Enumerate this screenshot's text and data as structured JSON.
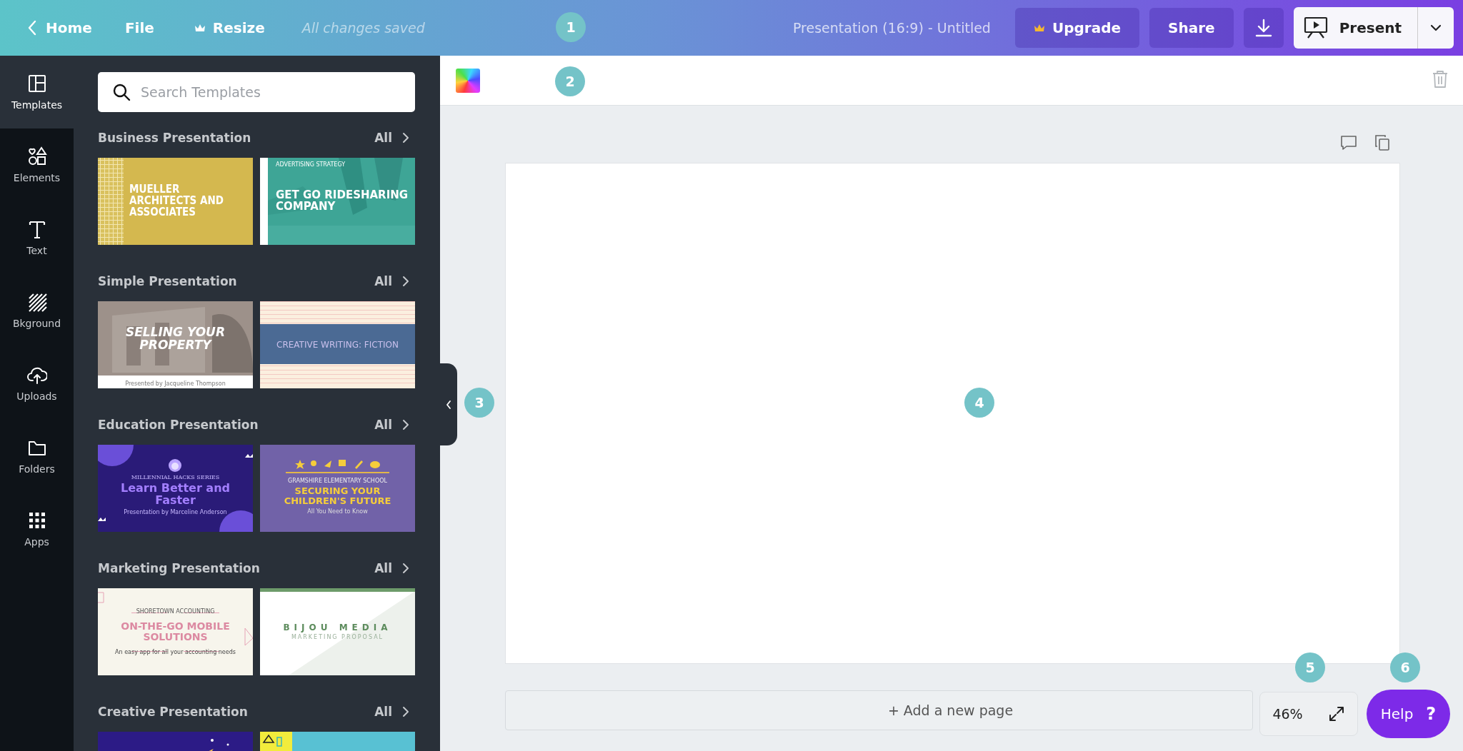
{
  "top_bar": {
    "home_link": "Home",
    "file_menu": "File",
    "resize_menu": "Resize",
    "save_status": "All changes saved",
    "document_title": "Presentation (16:9) - Untitled",
    "upgrade_button": "Upgrade",
    "share_button": "Share",
    "present_button": "Present"
  },
  "side_rail": [
    {
      "label": "Templates",
      "selected": true
    },
    {
      "label": "Elements",
      "selected": false
    },
    {
      "label": "Text",
      "selected": false
    },
    {
      "label": "Bkground",
      "selected": false
    },
    {
      "label": "Uploads",
      "selected": false
    },
    {
      "label": "Folders",
      "selected": false
    },
    {
      "label": "Apps",
      "selected": false
    }
  ],
  "template_panel": {
    "search": {
      "placeholder": "Search Templates"
    },
    "sections": [
      {
        "title": "Business Presentation",
        "all_link": "All",
        "templates": [
          {
            "kind": "design",
            "texts": [
              {
                "kind": "title",
                "text": "MUELLER ARCHITECTS AND ASSOCIATES"
              }
            ]
          },
          {
            "kind": "design",
            "texts": [
              {
                "kind": "kicker",
                "text": "ADVERTISING STRATEGY"
              },
              {
                "kind": "title",
                "text": "GET GO RIDESHARING COMPANY"
              }
            ]
          }
        ]
      },
      {
        "title": "Simple Presentation",
        "all_link": "All",
        "templates": [
          {
            "kind": "design",
            "texts": [
              {
                "kind": "title",
                "text": "SELLING YOUR PROPERTY"
              },
              {
                "kind": "footer",
                "text": "Presented by Jacqueline Thompson"
              }
            ]
          },
          {
            "kind": "design",
            "texts": [
              {
                "kind": "title",
                "text": "CREATIVE WRITING: FICTION"
              }
            ]
          }
        ]
      },
      {
        "title": "Education Presentation",
        "all_link": "All",
        "templates": [
          {
            "kind": "design",
            "texts": [
              {
                "kind": "kicker",
                "text": "MILLENNIAL HACKS SERIES"
              },
              {
                "kind": "title",
                "text": "Learn Better and Faster"
              },
              {
                "kind": "byline",
                "text": "Presentation by Marceline Anderson"
              }
            ]
          },
          {
            "kind": "design",
            "texts": [
              {
                "kind": "kicker",
                "text": "GRAMSHIRE ELEMENTARY SCHOOL"
              },
              {
                "kind": "title",
                "text": "SECURING YOUR CHILDREN'S FUTURE"
              },
              {
                "kind": "byline",
                "text": "All You Need to Know"
              }
            ]
          }
        ]
      },
      {
        "title": "Marketing Presentation",
        "all_link": "All",
        "templates": [
          {
            "kind": "design",
            "texts": [
              {
                "kind": "kicker",
                "text": "SHORETOWN ACCOUNTING"
              },
              {
                "kind": "title",
                "text": "ON-THE-GO MOBILE SOLUTIONS"
              },
              {
                "kind": "byline",
                "text": "An easy app for all your accounting needs"
              }
            ]
          },
          {
            "kind": "design",
            "texts": [
              {
                "kind": "title",
                "text": "BIJOU MEDIA"
              },
              {
                "kind": "byline",
                "text": "MARKETING PROPOSAL"
              }
            ]
          }
        ]
      },
      {
        "title": "Creative Presentation",
        "all_link": "All",
        "templates": [
          {
            "kind": "design"
          },
          {
            "kind": "design"
          }
        ]
      }
    ]
  },
  "editor": {
    "zoom_level": "46%",
    "add_page_button": "+ Add a new page",
    "help_button": "Help",
    "help_icon": "?"
  },
  "callouts": [
    "1",
    "2",
    "3",
    "4",
    "5",
    "6"
  ]
}
